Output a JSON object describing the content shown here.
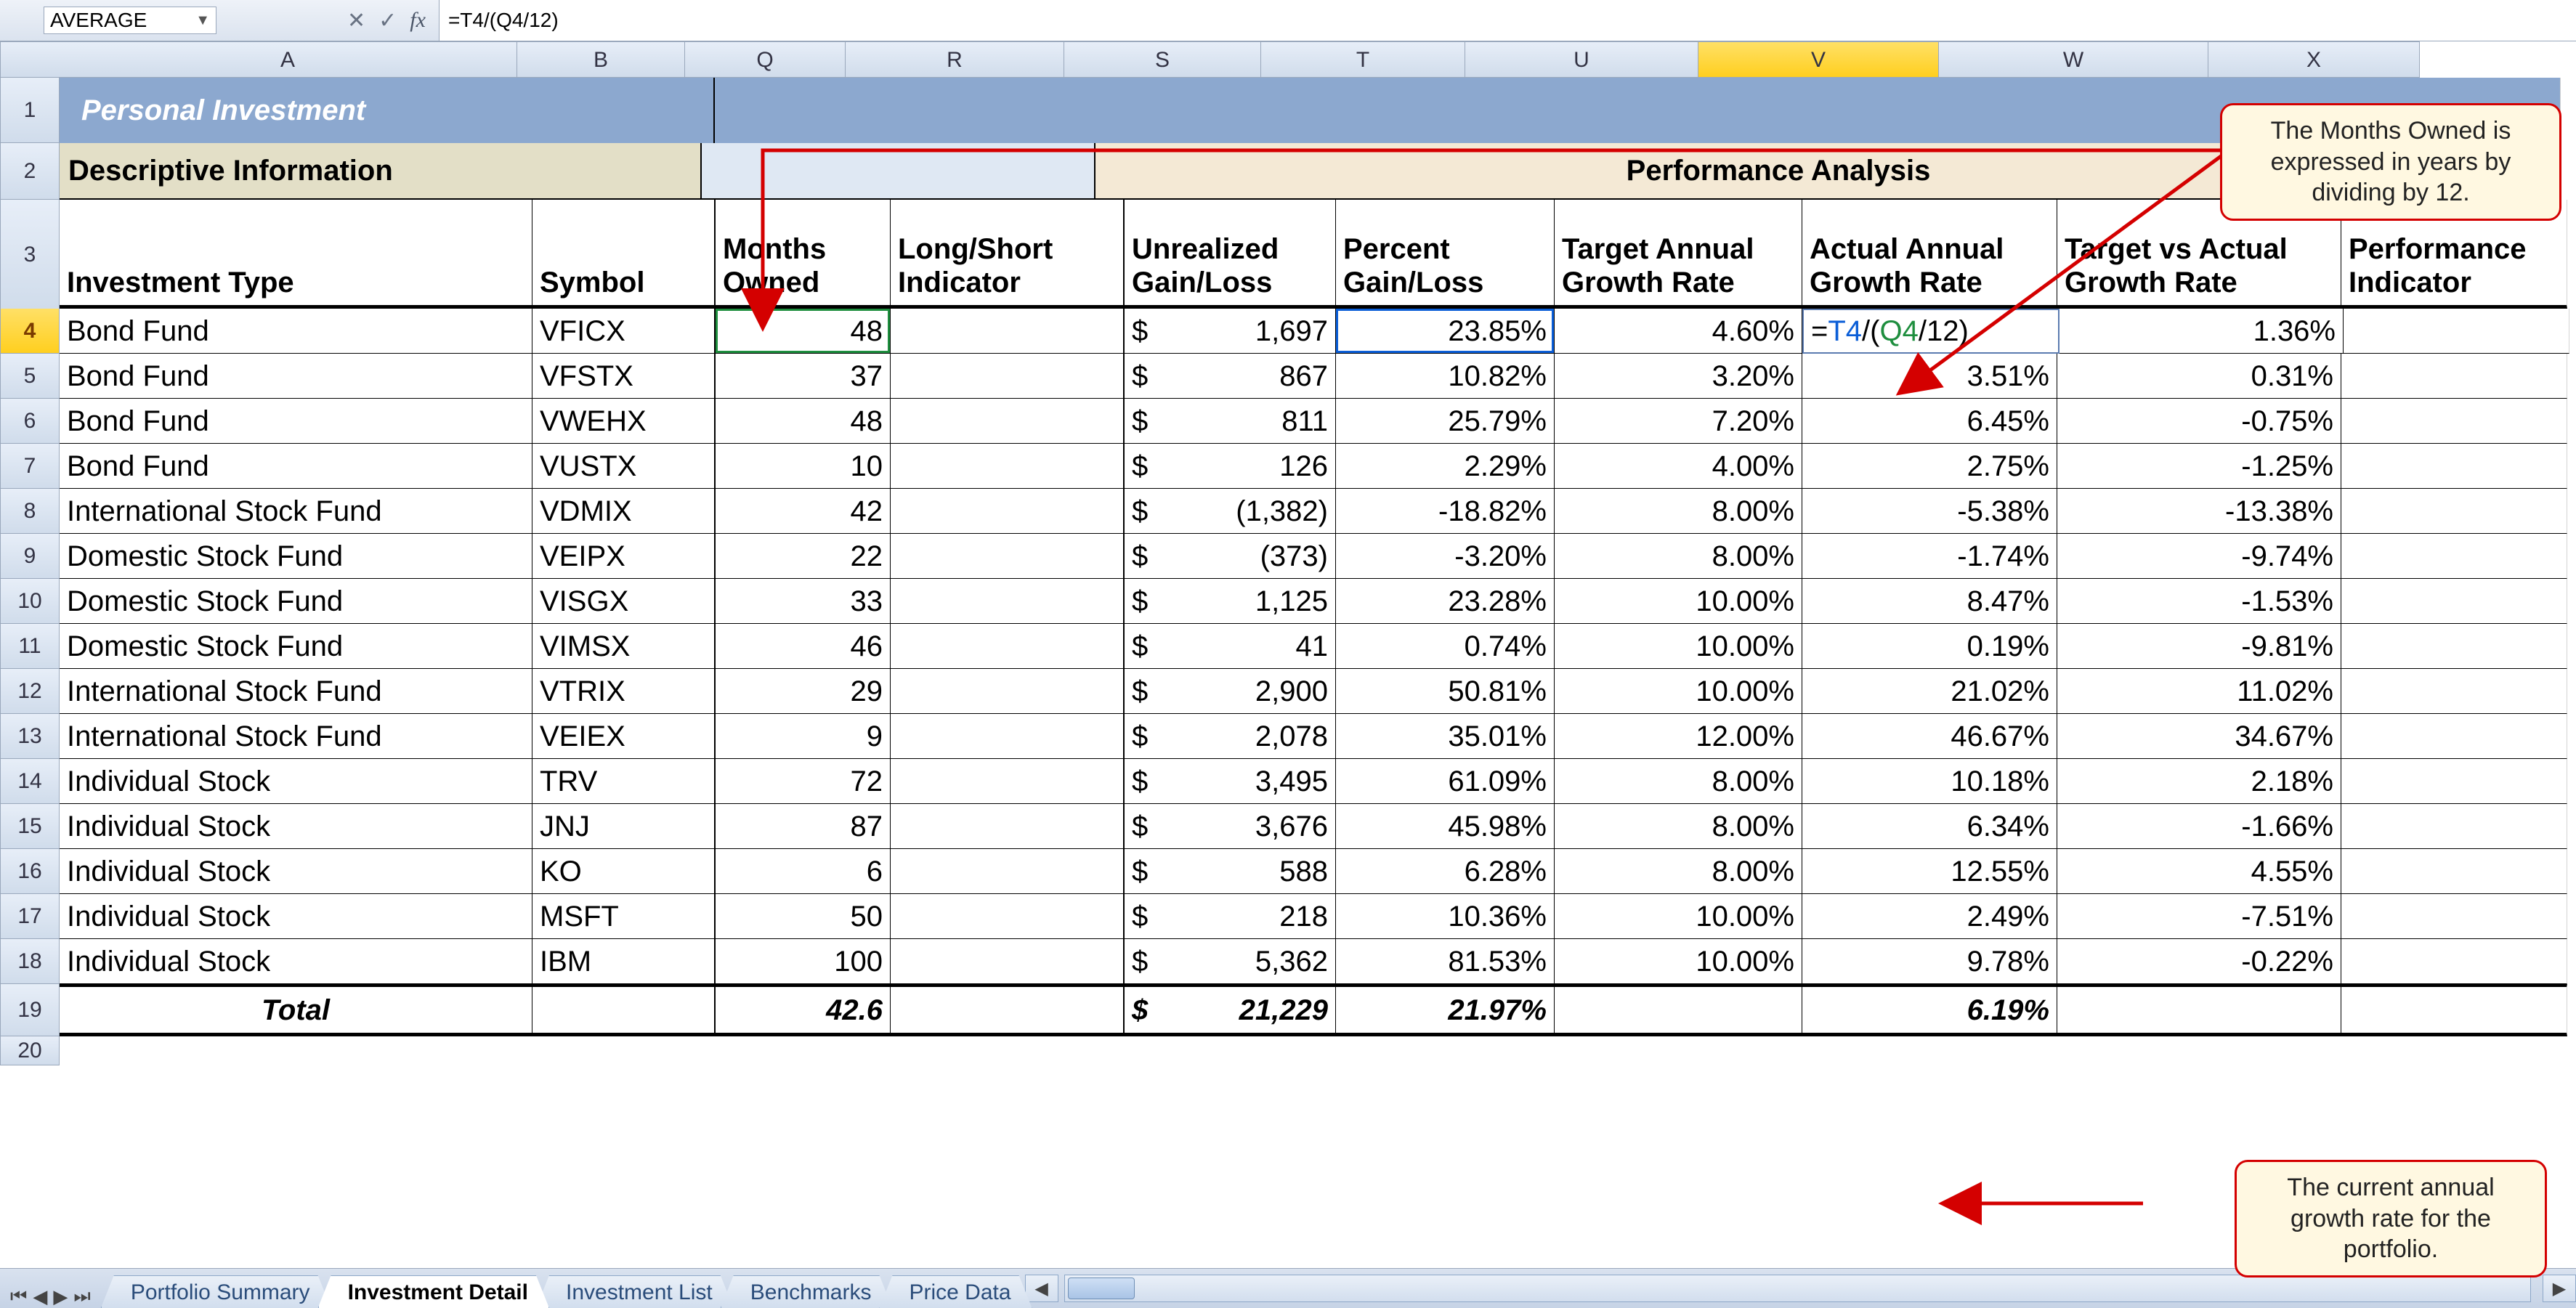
{
  "name_box": "AVERAGE",
  "formula": "=T4/(Q4/12)",
  "columns": [
    "A",
    "B",
    "Q",
    "R",
    "S",
    "T",
    "U",
    "V",
    "W",
    "X"
  ],
  "active_col": "V",
  "active_row": 4,
  "row1_title": "Personal Investment",
  "row2_desc": "Descriptive Information",
  "row2_perf": "Performance Analysis",
  "row3_headers": {
    "A": "Investment Type",
    "B": "Symbol",
    "Q": "Months Owned",
    "R": "Long/Short Indicator",
    "S": "Unrealized Gain/Loss",
    "T": "Percent Gain/Loss",
    "U": "Target Annual Growth Rate",
    "V": "Actual Annual Growth Rate",
    "W": "Target vs Actual Growth Rate",
    "X": "Performance Indicator"
  },
  "editing_cell_text": "=T4/(Q4/12)",
  "rows": [
    {
      "n": 4,
      "A": "Bond Fund",
      "B": "VFICX",
      "Q": "48",
      "R": "",
      "S_sym": "$",
      "S_val": "1,697",
      "T": "23.85%",
      "U": "4.60%",
      "V": "=T4/(Q4/12)",
      "W": "1.36%",
      "X": ""
    },
    {
      "n": 5,
      "A": "Bond Fund",
      "B": "VFSTX",
      "Q": "37",
      "R": "",
      "S_sym": "$",
      "S_val": "867",
      "T": "10.82%",
      "U": "3.20%",
      "V": "3.51%",
      "W": "0.31%",
      "X": ""
    },
    {
      "n": 6,
      "A": "Bond Fund",
      "B": "VWEHX",
      "Q": "48",
      "R": "",
      "S_sym": "$",
      "S_val": "811",
      "T": "25.79%",
      "U": "7.20%",
      "V": "6.45%",
      "W": "-0.75%",
      "X": ""
    },
    {
      "n": 7,
      "A": "Bond Fund",
      "B": "VUSTX",
      "Q": "10",
      "R": "",
      "S_sym": "$",
      "S_val": "126",
      "T": "2.29%",
      "U": "4.00%",
      "V": "2.75%",
      "W": "-1.25%",
      "X": ""
    },
    {
      "n": 8,
      "A": "International Stock Fund",
      "B": "VDMIX",
      "Q": "42",
      "R": "",
      "S_sym": "$",
      "S_val": "(1,382)",
      "T": "-18.82%",
      "U": "8.00%",
      "V": "-5.38%",
      "W": "-13.38%",
      "X": ""
    },
    {
      "n": 9,
      "A": "Domestic Stock Fund",
      "B": "VEIPX",
      "Q": "22",
      "R": "",
      "S_sym": "$",
      "S_val": "(373)",
      "T": "-3.20%",
      "U": "8.00%",
      "V": "-1.74%",
      "W": "-9.74%",
      "X": ""
    },
    {
      "n": 10,
      "A": "Domestic Stock Fund",
      "B": "VISGX",
      "Q": "33",
      "R": "",
      "S_sym": "$",
      "S_val": "1,125",
      "T": "23.28%",
      "U": "10.00%",
      "V": "8.47%",
      "W": "-1.53%",
      "X": ""
    },
    {
      "n": 11,
      "A": "Domestic Stock Fund",
      "B": "VIMSX",
      "Q": "46",
      "R": "",
      "S_sym": "$",
      "S_val": "41",
      "T": "0.74%",
      "U": "10.00%",
      "V": "0.19%",
      "W": "-9.81%",
      "X": ""
    },
    {
      "n": 12,
      "A": "International Stock Fund",
      "B": "VTRIX",
      "Q": "29",
      "R": "",
      "S_sym": "$",
      "S_val": "2,900",
      "T": "50.81%",
      "U": "10.00%",
      "V": "21.02%",
      "W": "11.02%",
      "X": ""
    },
    {
      "n": 13,
      "A": "International Stock Fund",
      "B": "VEIEX",
      "Q": "9",
      "R": "",
      "S_sym": "$",
      "S_val": "2,078",
      "T": "35.01%",
      "U": "12.00%",
      "V": "46.67%",
      "W": "34.67%",
      "X": ""
    },
    {
      "n": 14,
      "A": "Individual Stock",
      "B": "TRV",
      "Q": "72",
      "R": "",
      "S_sym": "$",
      "S_val": "3,495",
      "T": "61.09%",
      "U": "8.00%",
      "V": "10.18%",
      "W": "2.18%",
      "X": ""
    },
    {
      "n": 15,
      "A": "Individual Stock",
      "B": "JNJ",
      "Q": "87",
      "R": "",
      "S_sym": "$",
      "S_val": "3,676",
      "T": "45.98%",
      "U": "8.00%",
      "V": "6.34%",
      "W": "-1.66%",
      "X": ""
    },
    {
      "n": 16,
      "A": "Individual Stock",
      "B": "KO",
      "Q": "6",
      "R": "",
      "S_sym": "$",
      "S_val": "588",
      "T": "6.28%",
      "U": "8.00%",
      "V": "12.55%",
      "W": "4.55%",
      "X": ""
    },
    {
      "n": 17,
      "A": "Individual Stock",
      "B": "MSFT",
      "Q": "50",
      "R": "",
      "S_sym": "$",
      "S_val": "218",
      "T": "10.36%",
      "U": "10.00%",
      "V": "2.49%",
      "W": "-7.51%",
      "X": ""
    },
    {
      "n": 18,
      "A": "Individual Stock",
      "B": "IBM",
      "Q": "100",
      "R": "",
      "S_sym": "$",
      "S_val": "5,362",
      "T": "81.53%",
      "U": "10.00%",
      "V": "9.78%",
      "W": "-0.22%",
      "X": ""
    }
  ],
  "total_row": {
    "n": 19,
    "A": "Total",
    "Q": "42.6",
    "S_sym": "$",
    "S_val": "21,229",
    "T": "21.97%",
    "V": "6.19%"
  },
  "callouts": {
    "months_owned": "The Months Owned is expressed in years by dividing by 12.",
    "annual_growth": "The current annual growth rate for the portfolio."
  },
  "tabs": [
    "Portfolio Summary",
    "Investment Detail",
    "Investment List",
    "Benchmarks",
    "Price Data"
  ],
  "active_tab": "Investment Detail"
}
